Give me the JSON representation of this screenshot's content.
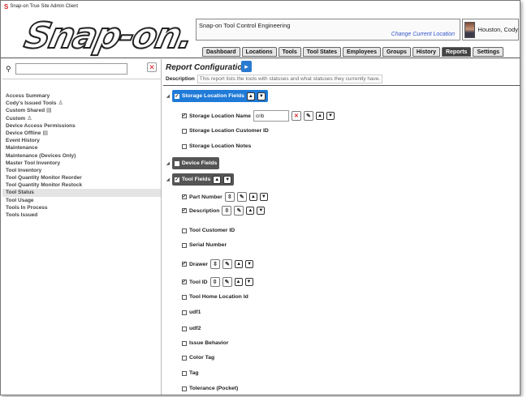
{
  "window": {
    "title": "Snap-on True Site Admin Client"
  },
  "brand": {
    "logo_text": "Snap-on."
  },
  "location": {
    "name": "Snap-on Tool Control Engineering",
    "change_link": "Change Current Location"
  },
  "user": {
    "name": "Houston, Cody"
  },
  "tabs": [
    "Dashboard",
    "Locations",
    "Tools",
    "Tool States",
    "Employees",
    "Groups",
    "History",
    "Reports",
    "Settings"
  ],
  "active_tab": "Reports",
  "search": {
    "placeholder": "",
    "value": ""
  },
  "reports": [
    {
      "label": "Access Summary",
      "icon": ""
    },
    {
      "label": "Cody's Issued Tools",
      "icon": "person-icon"
    },
    {
      "label": "Custom Shared",
      "icon": "shared-icon"
    },
    {
      "label": "Custom",
      "icon": "person-icon"
    },
    {
      "label": "Device Access Permissions",
      "icon": ""
    },
    {
      "label": "Device Offline",
      "icon": "shared-icon"
    },
    {
      "label": "Event History",
      "icon": ""
    },
    {
      "label": "Maintenance",
      "icon": ""
    },
    {
      "label": "Maintenance (Devices Only)",
      "icon": ""
    },
    {
      "label": "Master Tool Inventory",
      "icon": ""
    },
    {
      "label": "Tool Inventory",
      "icon": ""
    },
    {
      "label": "Tool Quantity Monitor Reorder",
      "icon": ""
    },
    {
      "label": "Tool Quantity Monitor Restock",
      "icon": ""
    },
    {
      "label": "Tool Status",
      "icon": "",
      "selected": true
    },
    {
      "label": "Tool Usage",
      "icon": ""
    },
    {
      "label": "Tools In Process",
      "icon": ""
    },
    {
      "label": "Tools Issued",
      "icon": ""
    }
  ],
  "config": {
    "title": "Report Configuration",
    "desc_label": "Description",
    "desc_value": "This report lists the tools with statuses and what statuses they currently have."
  },
  "storage_group": {
    "label": "Storage Location Fields",
    "checked": true
  },
  "storage_fields": [
    {
      "label": "Storage Location Name",
      "checked": true,
      "filter_value": "crib"
    },
    {
      "label": "Storage Location Customer ID",
      "checked": false
    },
    {
      "label": "Storage Location Notes",
      "checked": false
    }
  ],
  "device_group": {
    "label": "Device Fields",
    "checked": false
  },
  "tool_group": {
    "label": "Tool Fields",
    "checked": true
  },
  "tool_fields": [
    {
      "label": "Part Number",
      "checked": true
    },
    {
      "label": "Description",
      "checked": true
    },
    {
      "label": "Tool Customer ID",
      "checked": false
    },
    {
      "label": "Serial Number",
      "checked": false
    },
    {
      "label": "Drawer",
      "checked": true
    },
    {
      "label": "Tool ID",
      "checked": true
    },
    {
      "label": "Tool Home Location Id",
      "checked": false
    },
    {
      "label": "udf1",
      "checked": false
    },
    {
      "label": "udf2",
      "checked": false
    },
    {
      "label": "Issue Behavior",
      "checked": false
    },
    {
      "label": "Color Tag",
      "checked": false
    },
    {
      "label": "Tag",
      "checked": false
    },
    {
      "label": "Tolerance (Pocket)",
      "checked": false
    }
  ],
  "glyphs": {
    "up": "▲",
    "down": "▼",
    "sort": "⇳",
    "edit": "✎",
    "clear": "✕"
  }
}
